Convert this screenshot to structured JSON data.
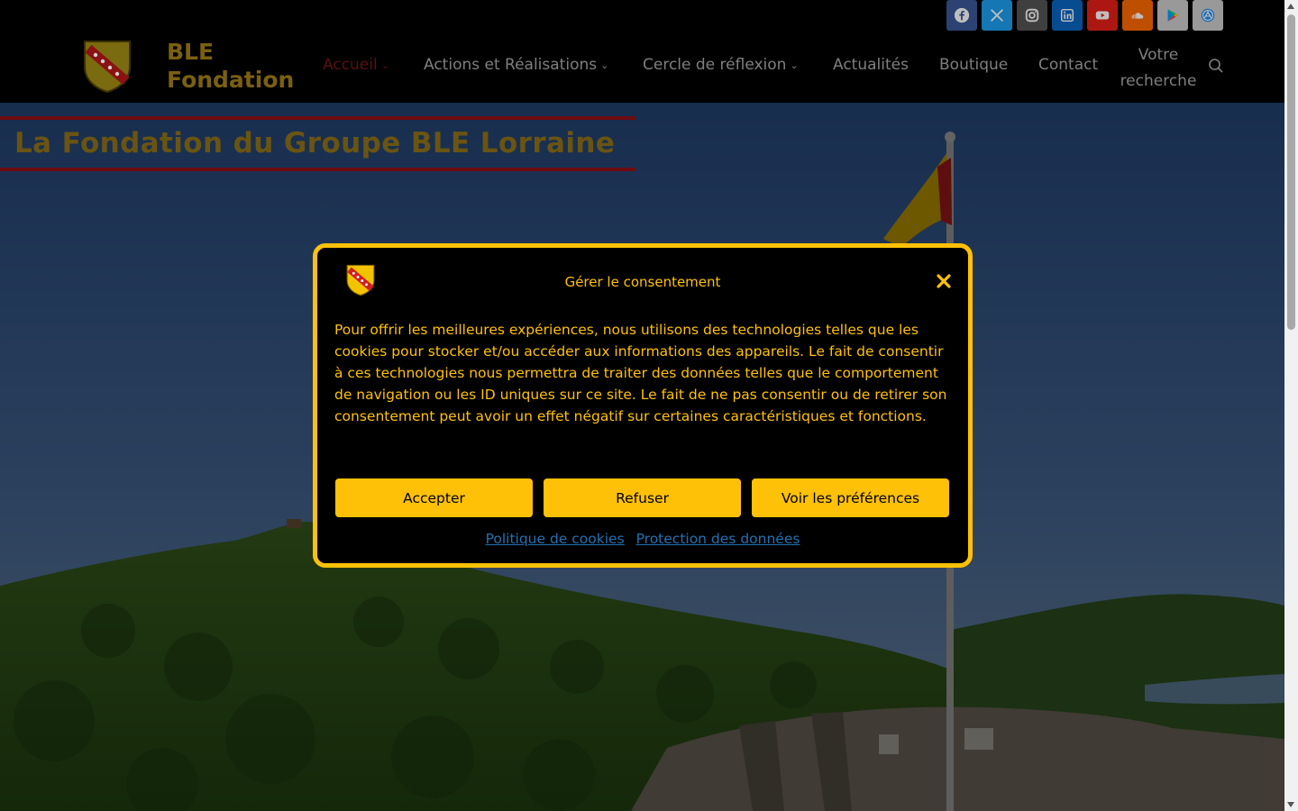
{
  "colors": {
    "accent": "#ffc107",
    "header_bg": "#000000",
    "title_rule": "#6e0c10",
    "link": "#2271b1"
  },
  "header": {
    "social_links": [
      {
        "name": "facebook-icon",
        "color": "#3b5998"
      },
      {
        "name": "x-twitter-icon",
        "color": "#1da1f2"
      },
      {
        "name": "instagram-icon",
        "color": "#555555"
      },
      {
        "name": "linkedin-icon",
        "color": "#0a66c2"
      },
      {
        "name": "youtube-icon",
        "color": "#e62117"
      },
      {
        "name": "soundcloud-icon",
        "color": "#ff6a00"
      },
      {
        "name": "google-play-icon",
        "color": "#cccccc"
      },
      {
        "name": "app-store-icon",
        "color": "#cccccc"
      }
    ],
    "brand_line1": "BLE",
    "brand_line2": "Fondation",
    "nav": {
      "accueil": "Accueil",
      "actions": "Actions et Réalisations",
      "cercle": "Cercle de réflexion",
      "actualites": "Actualités",
      "boutique": "Boutique",
      "contact": "Contact",
      "search_line1": "Votre",
      "search_line2": "recherche"
    }
  },
  "page": {
    "title": "La Fondation du Groupe BLE Lorraine"
  },
  "consent": {
    "title": "Gérer le consentement",
    "body": "Pour offrir les meilleures expériences, nous utilisons des technologies telles que les cookies pour stocker et/ou accéder aux informations des appareils. Le fait de consentir à ces technologies nous permettra de traiter des données telles que le comportement de navigation ou les ID uniques sur ce site. Le fait de ne pas consentir ou de retirer son consentement peut avoir un effet négatif sur certaines caractéristiques et fonctions.",
    "accept": "Accepter",
    "refuse": "Refuser",
    "preferences": "Voir les préférences",
    "cookie_policy": "Politique de cookies",
    "data_protection": "Protection des données"
  }
}
